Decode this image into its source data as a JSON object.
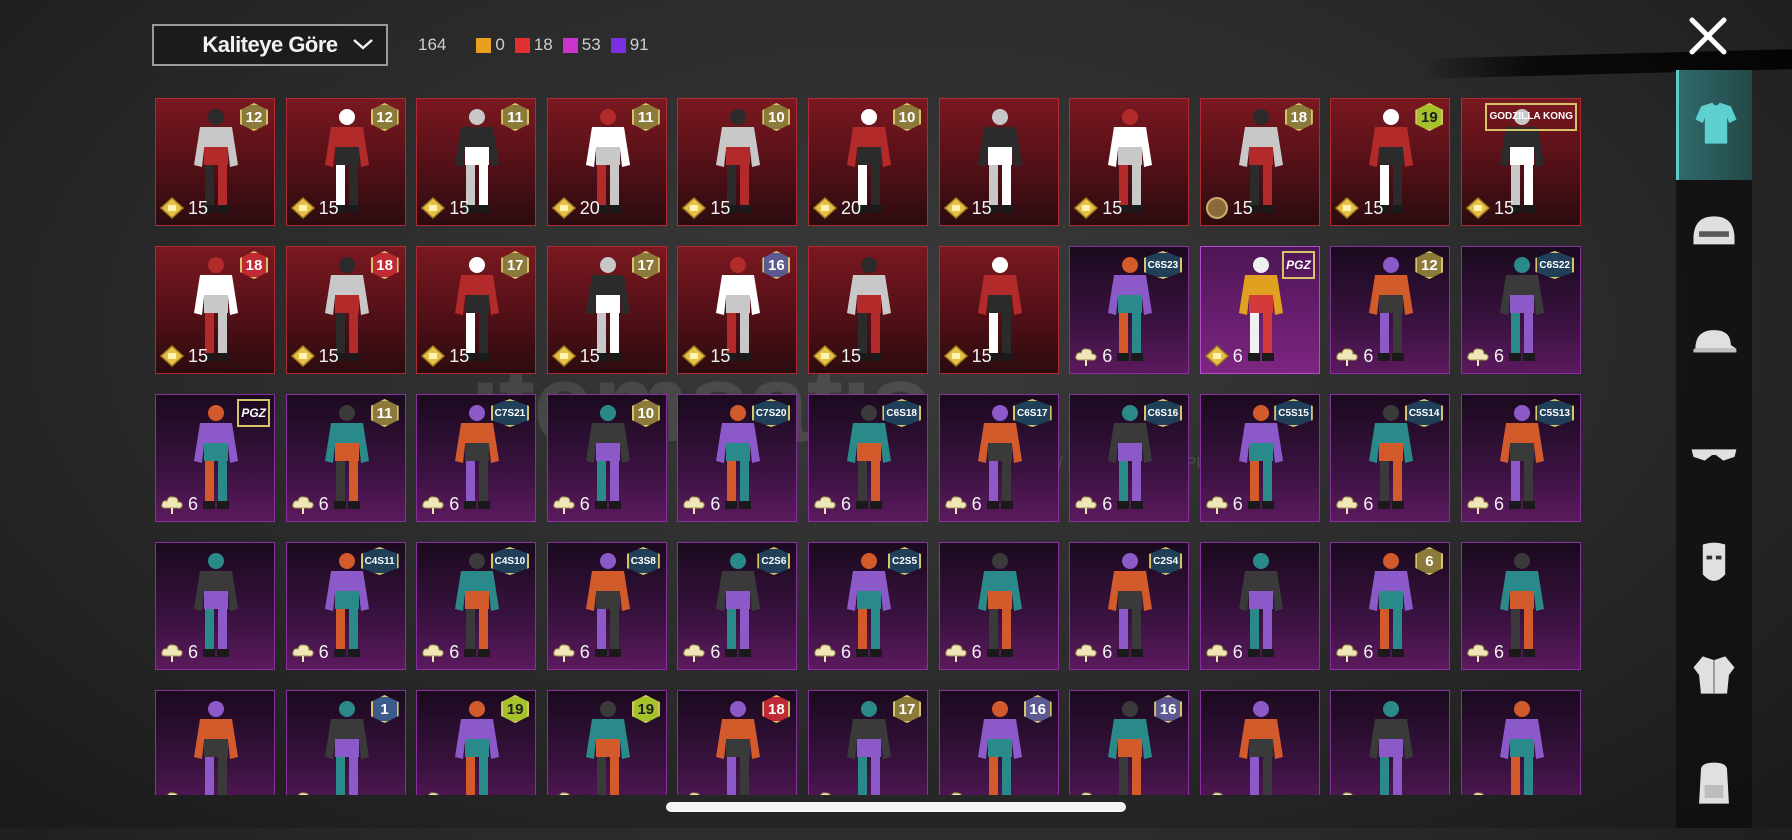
{
  "sort": {
    "label": "Kaliteye Göre"
  },
  "counts": {
    "total": "164",
    "qualities": [
      {
        "value": "0",
        "color": "#e8a020"
      },
      {
        "value": "18",
        "color": "#e23030"
      },
      {
        "value": "53",
        "color": "#cc33cc"
      },
      {
        "value": "91",
        "color": "#7a30e0"
      }
    ]
  },
  "watermark": {
    "brand": "itemsatis",
    "tagline": "HESAP / SKIN / ITEM / E-PIN .COM"
  },
  "sidebar": {
    "tabs": [
      "outfit-icon",
      "helmet-icon",
      "cap-icon",
      "glasses-icon",
      "mask-icon",
      "jacket-icon",
      "backpack-icon"
    ]
  },
  "grid": {
    "rows": [
      [
        {
          "badge": "12",
          "cost": "15",
          "style": "red",
          "currency": "gold",
          "badge_type": "num"
        },
        {
          "badge": "12",
          "cost": "15",
          "style": "red",
          "currency": "gold",
          "badge_type": "num"
        },
        {
          "badge": "11",
          "cost": "15",
          "style": "red",
          "currency": "gold",
          "badge_type": "num"
        },
        {
          "badge": "11",
          "cost": "20",
          "style": "red",
          "currency": "gold",
          "badge_type": "num"
        },
        {
          "badge": "10",
          "cost": "15",
          "style": "red",
          "currency": "gold",
          "badge_type": "num"
        },
        {
          "badge": "10",
          "cost": "20",
          "style": "red",
          "currency": "gold",
          "badge_type": "num"
        },
        {
          "badge": "",
          "cost": "15",
          "style": "red",
          "currency": "gold",
          "badge_type": "none"
        },
        {
          "badge": "",
          "cost": "15",
          "style": "red",
          "currency": "gold",
          "badge_type": "none"
        },
        {
          "badge": "18",
          "cost": "15",
          "style": "red",
          "currency": "bronze",
          "badge_type": "num"
        },
        {
          "badge": "19",
          "cost": "15",
          "style": "red",
          "currency": "gold",
          "badge_type": "lime"
        },
        {
          "badge": "GODZILLA KONG",
          "cost": "15",
          "style": "red",
          "currency": "gold",
          "badge_type": "kong"
        }
      ],
      [
        {
          "badge": "18",
          "cost": "15",
          "style": "red",
          "currency": "gold",
          "badge_type": "red"
        },
        {
          "badge": "18",
          "cost": "15",
          "style": "red",
          "currency": "gold",
          "badge_type": "red"
        },
        {
          "badge": "17",
          "cost": "15",
          "style": "red",
          "currency": "gold",
          "badge_type": "num"
        },
        {
          "badge": "17",
          "cost": "15",
          "style": "red",
          "currency": "gold",
          "badge_type": "num"
        },
        {
          "badge": "16",
          "cost": "15",
          "style": "red",
          "currency": "gold",
          "badge_type": "blue"
        },
        {
          "badge": "",
          "cost": "15",
          "style": "red",
          "currency": "gold",
          "badge_type": "none"
        },
        {
          "badge": "",
          "cost": "15",
          "style": "red",
          "currency": "gold",
          "badge_type": "none"
        },
        {
          "badge": "C6S23",
          "cost": "6",
          "style": "purple",
          "currency": "cloud",
          "badge_type": "season"
        },
        {
          "badge": "PGZ",
          "cost": "6",
          "style": "selected",
          "currency": "gold",
          "badge_type": "pgz"
        },
        {
          "badge": "12",
          "cost": "6",
          "style": "purple",
          "currency": "cloud",
          "badge_type": "num"
        },
        {
          "badge": "C6S22",
          "cost": "6",
          "style": "purple",
          "currency": "cloud",
          "badge_type": "season"
        }
      ],
      [
        {
          "badge": "PGZ",
          "cost": "6",
          "style": "purple",
          "currency": "cloud",
          "badge_type": "pgz"
        },
        {
          "badge": "11",
          "cost": "6",
          "style": "purple",
          "currency": "cloud",
          "badge_type": "num"
        },
        {
          "badge": "C7S21",
          "cost": "6",
          "style": "purple",
          "currency": "cloud",
          "badge_type": "season"
        },
        {
          "badge": "10",
          "cost": "6",
          "style": "purple",
          "currency": "cloud",
          "badge_type": "num"
        },
        {
          "badge": "C7S20",
          "cost": "6",
          "style": "purple",
          "currency": "cloud",
          "badge_type": "season"
        },
        {
          "badge": "C6S18",
          "cost": "6",
          "style": "purple",
          "currency": "cloud",
          "badge_type": "season"
        },
        {
          "badge": "C6S17",
          "cost": "6",
          "style": "purple",
          "currency": "cloud",
          "badge_type": "season"
        },
        {
          "badge": "C6S16",
          "cost": "6",
          "style": "purple",
          "currency": "cloud",
          "badge_type": "season"
        },
        {
          "badge": "C5S15",
          "cost": "6",
          "style": "purple",
          "currency": "cloud",
          "badge_type": "season"
        },
        {
          "badge": "C5S14",
          "cost": "6",
          "style": "purple",
          "currency": "cloud",
          "badge_type": "season"
        },
        {
          "badge": "C5S13",
          "cost": "6",
          "style": "purple",
          "currency": "cloud",
          "badge_type": "season"
        }
      ],
      [
        {
          "badge": "",
          "cost": "6",
          "style": "purple",
          "currency": "cloud",
          "badge_type": "none"
        },
        {
          "badge": "C4S11",
          "cost": "6",
          "style": "purple",
          "currency": "cloud",
          "badge_type": "season"
        },
        {
          "badge": "C4S10",
          "cost": "6",
          "style": "purple",
          "currency": "cloud",
          "badge_type": "season"
        },
        {
          "badge": "C3S8",
          "cost": "6",
          "style": "purple",
          "currency": "cloud",
          "badge_type": "season"
        },
        {
          "badge": "C2S6",
          "cost": "6",
          "style": "purple",
          "currency": "cloud",
          "badge_type": "season"
        },
        {
          "badge": "C2S5",
          "cost": "6",
          "style": "purple",
          "currency": "cloud",
          "badge_type": "season"
        },
        {
          "badge": "",
          "cost": "6",
          "style": "purple",
          "currency": "cloud",
          "badge_type": "none"
        },
        {
          "badge": "C2S4",
          "cost": "6",
          "style": "purple",
          "currency": "cloud",
          "badge_type": "season"
        },
        {
          "badge": "",
          "cost": "6",
          "style": "purple",
          "currency": "cloud",
          "badge_type": "none"
        },
        {
          "badge": "6",
          "cost": "6",
          "style": "purple",
          "currency": "cloud",
          "badge_type": "num"
        },
        {
          "badge": "",
          "cost": "6",
          "style": "purple",
          "currency": "cloud",
          "badge_type": "none"
        }
      ],
      [
        {
          "badge": "",
          "cost": "",
          "style": "purple",
          "currency": "cloud",
          "badge_type": "none"
        },
        {
          "badge": "1",
          "cost": "",
          "style": "purple",
          "currency": "cloud",
          "badge_type": "sky"
        },
        {
          "badge": "19",
          "cost": "",
          "style": "purple",
          "currency": "cloud",
          "badge_type": "lime"
        },
        {
          "badge": "19",
          "cost": "",
          "style": "purple",
          "currency": "cloud",
          "badge_type": "lime"
        },
        {
          "badge": "18",
          "cost": "",
          "style": "purple",
          "currency": "cloud",
          "badge_type": "red"
        },
        {
          "badge": "17",
          "cost": "",
          "style": "purple",
          "currency": "cloud",
          "badge_type": "num"
        },
        {
          "badge": "16",
          "cost": "",
          "style": "purple",
          "currency": "cloud",
          "badge_type": "blue"
        },
        {
          "badge": "16",
          "cost": "",
          "style": "purple",
          "currency": "cloud",
          "badge_type": "blue"
        },
        {
          "badge": "",
          "cost": "",
          "style": "purple",
          "currency": "cloud",
          "badge_type": "none"
        },
        {
          "badge": "",
          "cost": "",
          "style": "purple",
          "currency": "cloud",
          "badge_type": "none"
        },
        {
          "badge": "",
          "cost": "",
          "style": "purple",
          "currency": "cloud",
          "badge_type": "none"
        }
      ]
    ]
  }
}
